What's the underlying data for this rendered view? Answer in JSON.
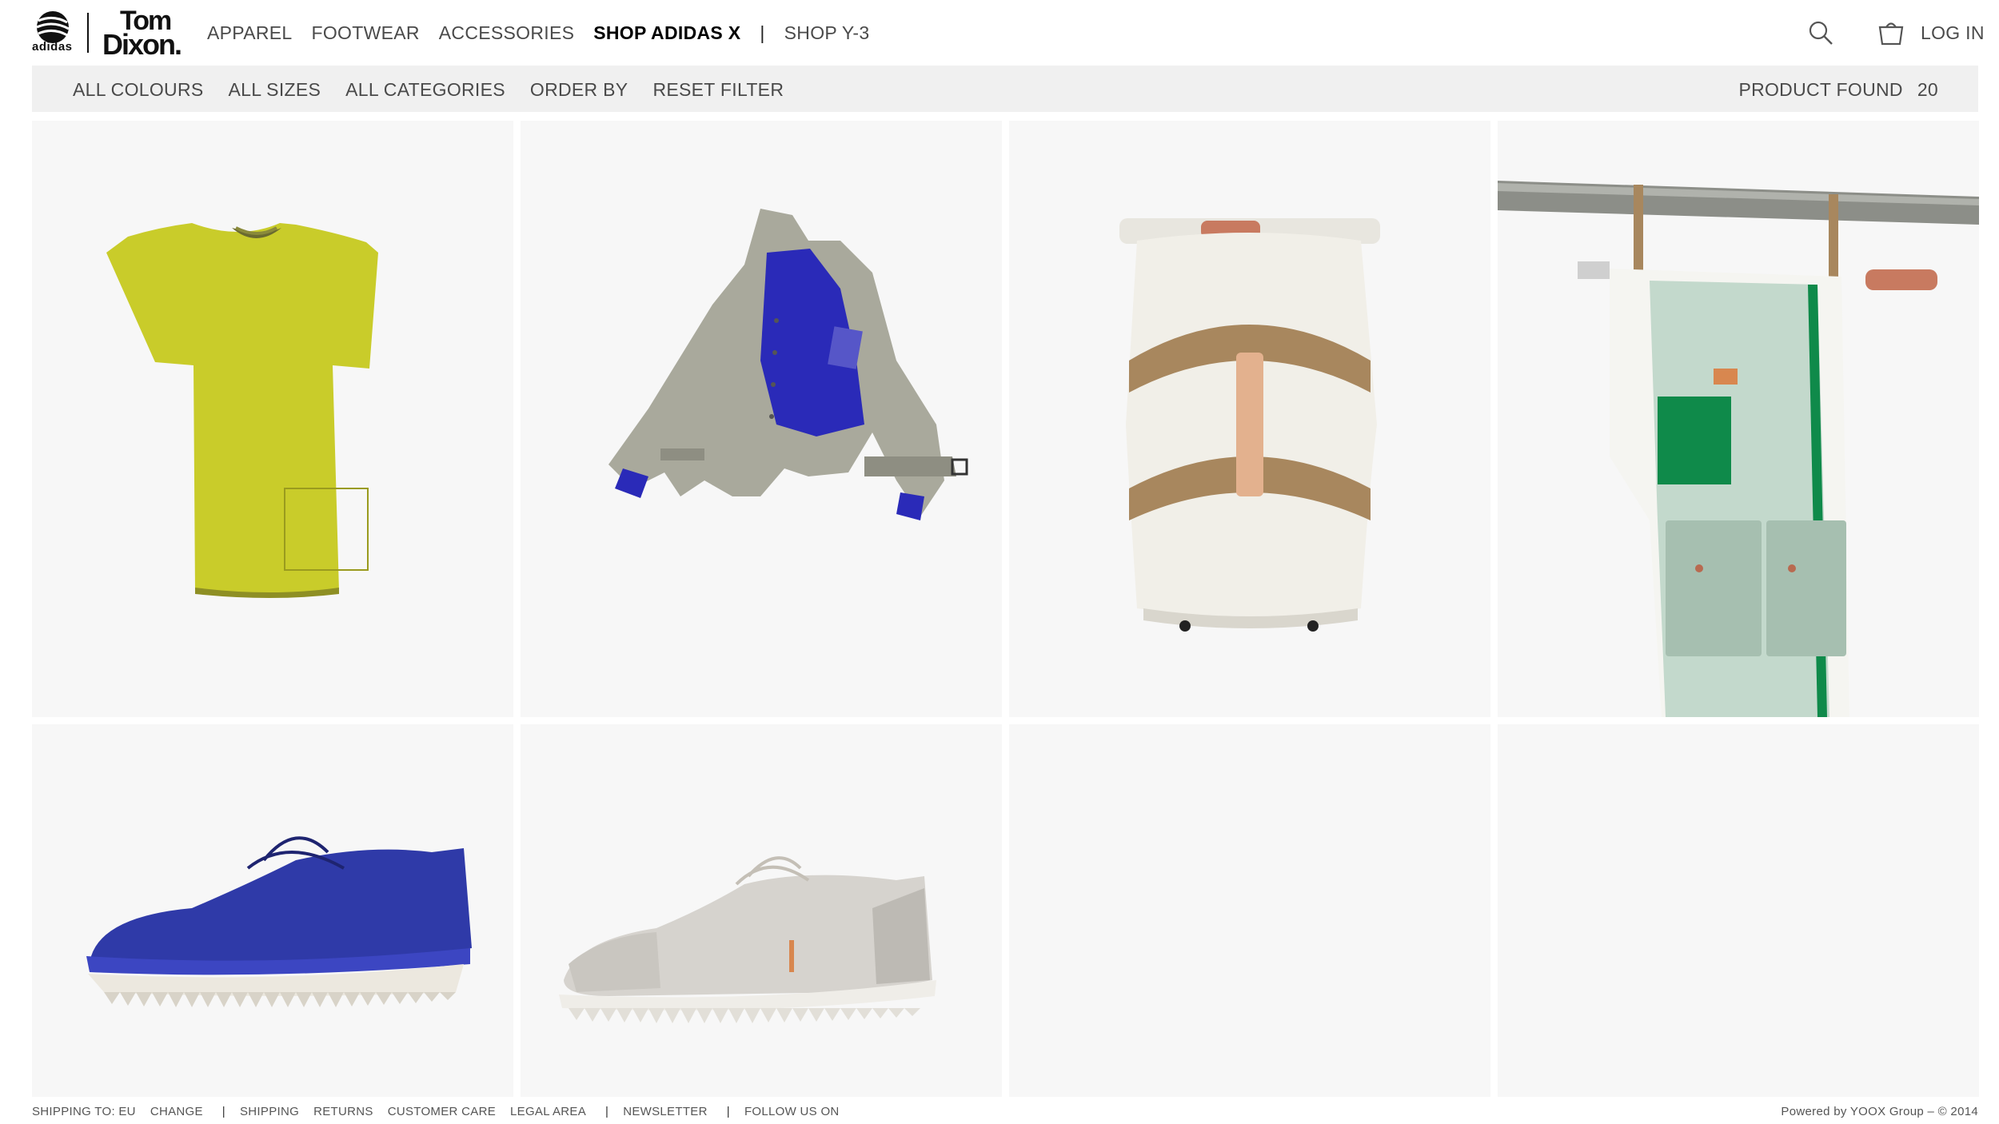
{
  "brand": {
    "adidas_text": "adidas",
    "partner_line1": "Tom",
    "partner_line2": "Dixon."
  },
  "nav": {
    "apparel": "APPAREL",
    "footwear": "FOOTWEAR",
    "accessories": "ACCESSORIES",
    "shop_adidas_x": "SHOP ADIDAS X",
    "separator": "|",
    "shop_y3": "SHOP Y-3",
    "login": "LOG IN"
  },
  "icons": {
    "search": "search-icon",
    "bag": "shopping-bag-icon"
  },
  "filters": {
    "colours": "ALL COLOURS",
    "sizes": "ALL SIZES",
    "categories": "ALL CATEGORIES",
    "order_by": "ORDER BY",
    "reset": "RESET FILTER",
    "found_label": "PRODUCT FOUND",
    "found_count": "20"
  },
  "products": [
    {
      "name": "product-yellow-tshirt",
      "color": "#c9cc2a"
    },
    {
      "name": "product-grey-jacket",
      "color": "#a9a99c"
    },
    {
      "name": "product-white-duffel-bag",
      "color": "#f1efe8"
    },
    {
      "name": "product-hanging-garment-bag",
      "color": "#c3d9cc"
    },
    {
      "name": "product-blue-shoe",
      "color": "#2f3aa8"
    },
    {
      "name": "product-grey-shoe",
      "color": "#d6d3ce"
    },
    {
      "name": "product-empty-1"
    },
    {
      "name": "product-empty-2"
    }
  ],
  "footer": {
    "shipping_to": "SHIPPING TO: EU",
    "change": "CHANGE",
    "sep": "|",
    "shipping": "SHIPPING",
    "returns": "RETURNS",
    "customer_care": "CUSTOMER CARE",
    "legal_area": "LEGAL AREA",
    "newsletter": "NEWSLETTER",
    "follow_us": "FOLLOW US ON",
    "powered": "Powered by YOOX Group  –  © 2014"
  }
}
